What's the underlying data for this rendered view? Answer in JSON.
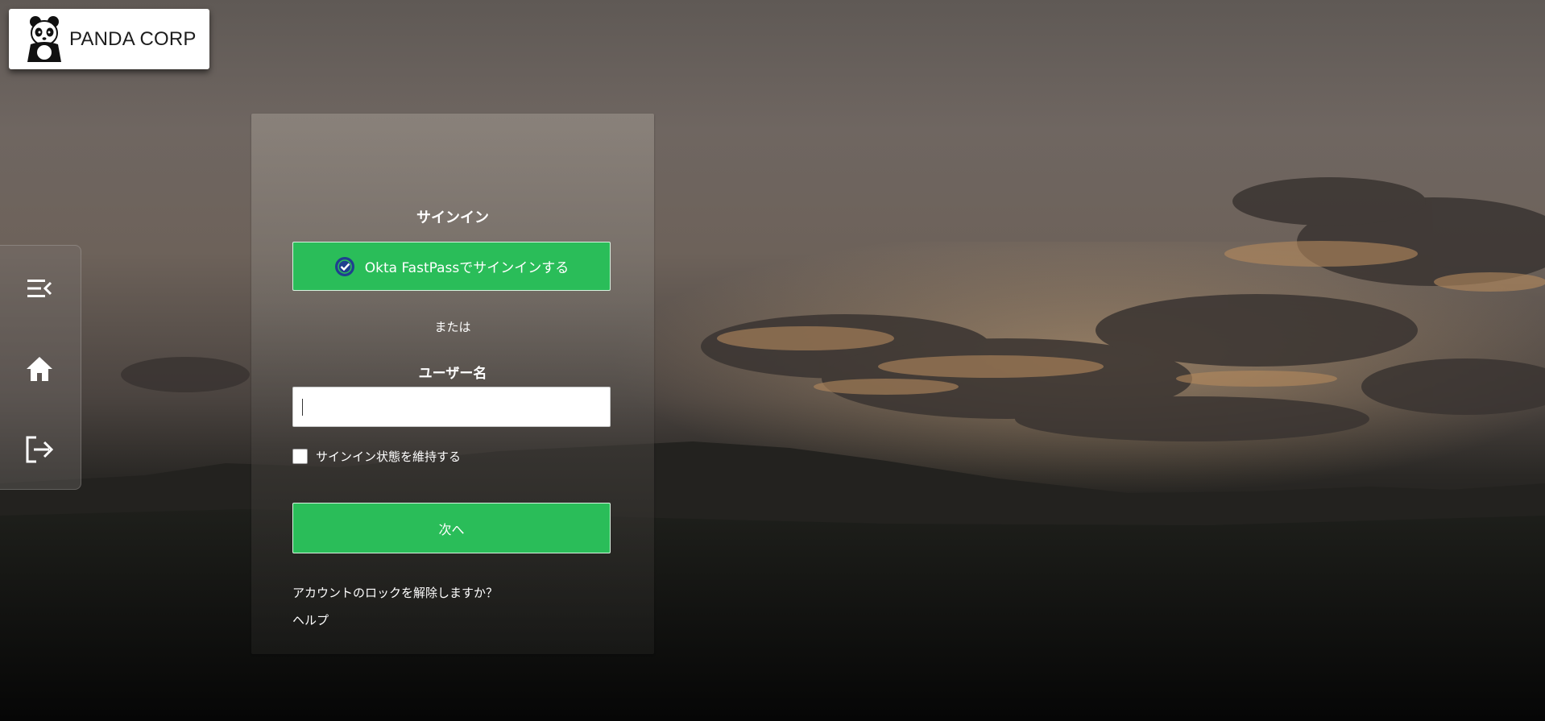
{
  "logo": {
    "brand_text": "PANDA CORP",
    "icon": "panda-icon"
  },
  "side_rail": {
    "items": [
      {
        "icon": "collapse-menu-icon"
      },
      {
        "icon": "home-icon"
      },
      {
        "icon": "logout-icon"
      }
    ]
  },
  "login": {
    "title": "サインイン",
    "fastpass_label": "Okta FastPassでサインインする",
    "fastpass_icon": "okta-verify-icon",
    "or_text": "または",
    "username_label": "ユーザー名",
    "username_value": "",
    "remember_label": "サインイン状態を維持する",
    "remember_checked": false,
    "next_label": "次へ",
    "unlock_link": "アカウントのロックを解除しますか？",
    "help_link": "ヘルプ"
  },
  "colors": {
    "primary_green": "#2abd59",
    "fastpass_icon_blue": "#1f3f8f"
  }
}
